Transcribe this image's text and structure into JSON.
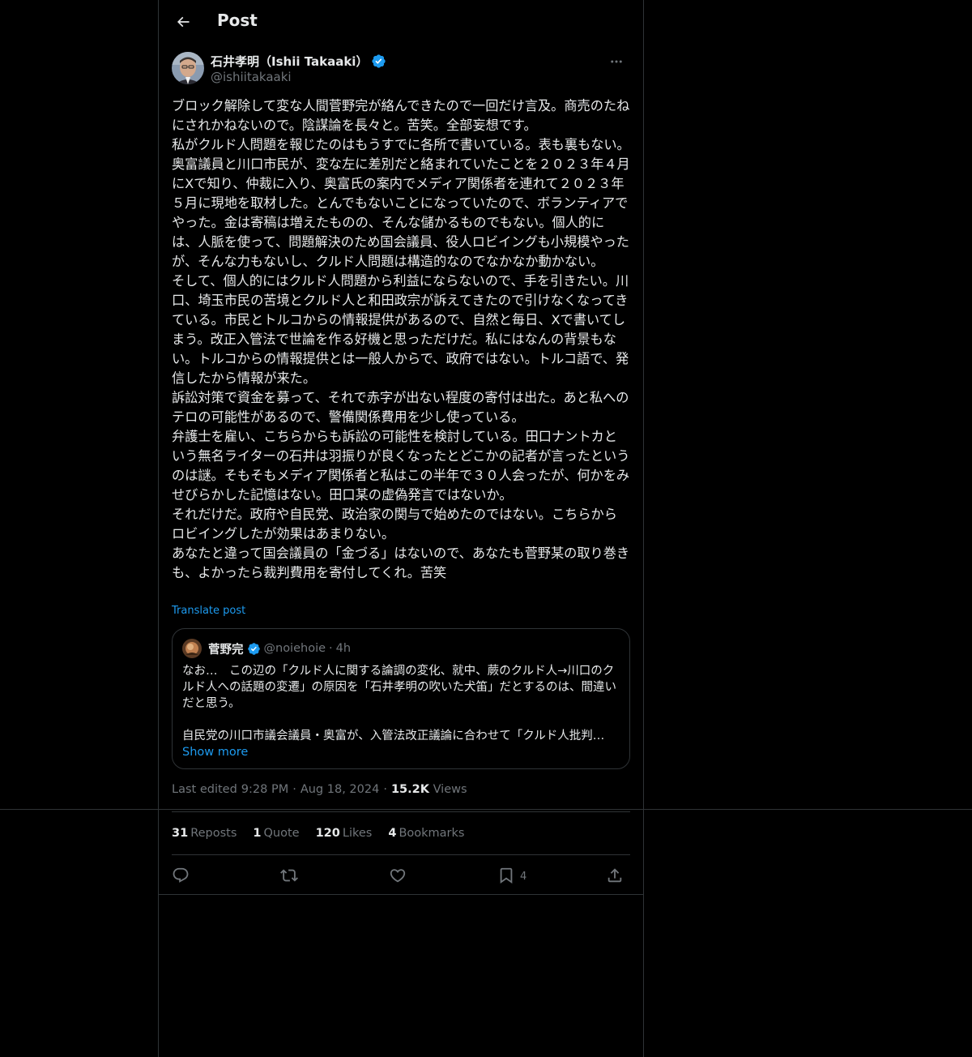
{
  "header": {
    "title": "Post",
    "back_icon": "arrow-left-icon"
  },
  "author": {
    "display_name": "石井孝明（Ishii Takaaki）",
    "handle": "@ishiitakaaki",
    "verified": true,
    "verified_color": "#1d9bf0"
  },
  "post": {
    "text": "ブロック解除して変な人間菅野完が絡んできたので一回だけ言及。商売のたねにされかねないので。陰謀論を長々と。苦笑。全部妄想です。\n私がクルド人問題を報じたのはもうすでに各所で書いている。表も裏もない。奥富議員と川口市民が、変な左に差別だと絡まれていたことを２０２３年４月にXで知り、仲裁に入り、奥富氏の案内でメディア関係者を連れて２０２３年５月に現地を取材した。とんでもないことになっていたので、ボランティアでやった。金は寄稿は増えたものの、そんな儲かるものでもない。個人的には、人脈を使って、問題解決のため国会議員、役人ロビイングも小規模やったが、そんな力もないし、クルド人問題は構造的なのでなかなか動かない。\nそして、個人的にはクルド人問題から利益にならないので、手を引きたい。川口、埼玉市民の苦境とクルド人と和田政宗が訴えてきたので引けなくなってきている。市民とトルコからの情報提供があるので、自然と毎日、Xで書いてしまう。改正入管法で世論を作る好機と思っただけだ。私にはなんの背景もない。トルコからの情報提供とは一般人からで、政府ではない。トルコ語で、発信したから情報が来た。\n訴訟対策で資金を募って、それで赤字が出ない程度の寄付は出た。あと私へのテロの可能性があるので、警備関係費用を少し使っている。\n弁護士を雇い、こちらからも訴訟の可能性を検討している。田口ナントカという無名ライターの石井は羽振りが良くなったとどこかの記者が言ったというのは謎。そもそもメディア関係者と私はこの半年で３０人会ったが、何かをみせびらかした記憶はない。田口某の虚偽発言ではないか。\nそれだけだ。政府や自民党、政治家の関与で始めたのではない。こちらからロビイングしたが効果はあまりない。\nあなたと違って国会議員の「金づる」はないので、あなたも菅野某の取り巻きも、よかったら裁判費用を寄付してくれ。苦笑",
    "translate_label": "Translate post",
    "edited_label": "Last edited",
    "time": "9:28 PM",
    "date": "Aug 18, 2024",
    "views_count": "15.2K",
    "views_label": "Views"
  },
  "quote": {
    "display_name": "菅野完",
    "verified": true,
    "handle": "@noiehoie",
    "separator": "·",
    "time": "4h",
    "text": "なお…　この辺の「クルド人に関する論調の変化、就中、蕨のクルド人→川口のクルド人への話題の変遷」の原因を「石井孝明の吹いた犬笛」だとするのは、間違いだと思う。",
    "text_line2": "自民党の川口市議会議員・奥富が、入管法改正議論に合わせて「クルド人批判…",
    "show_more": "Show more"
  },
  "stats": [
    {
      "count": "31",
      "label": "Reposts"
    },
    {
      "count": "1",
      "label": "Quote"
    },
    {
      "count": "120",
      "label": "Likes"
    },
    {
      "count": "4",
      "label": "Bookmarks"
    }
  ],
  "actions": {
    "reply_icon": "reply-icon",
    "repost_icon": "repost-icon",
    "like_icon": "heart-icon",
    "bookmark_icon": "bookmark-icon",
    "bookmark_count": "4",
    "share_icon": "share-icon"
  },
  "colors": {
    "background": "#000000",
    "text": "#e7e9ea",
    "secondary": "#71767b",
    "accent": "#1d9bf0",
    "border": "#2f3336"
  }
}
